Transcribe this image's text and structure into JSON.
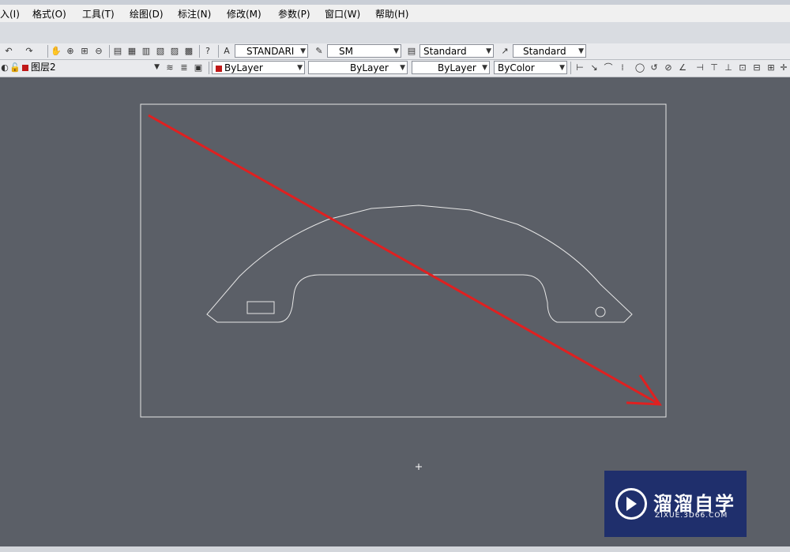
{
  "menu": [
    "入(I)",
    "格式(O)",
    "工具(T)",
    "绘图(D)",
    "标注(N)",
    "修改(M)",
    "参数(P)",
    "窗口(W)",
    "帮助(H)"
  ],
  "styles_toolbar": {
    "text_style": "STANDARI",
    "dim_style": "SM",
    "table_style": "Standard",
    "multileader_style": "Standard"
  },
  "layers_toolbar": {
    "current_layer": "图层2",
    "color": "ByLayer",
    "linetype": "ByLayer",
    "lineweight": "ByLayer",
    "plot_style": "ByColor"
  },
  "colors": {
    "canvas": "#5b5f67",
    "geometry": "#e6e6e6",
    "annotation_arrow": "#e02020",
    "layer_swatch": "#c01818"
  },
  "watermark": {
    "title": "溜溜自学",
    "url": "ZIXUE.3D66.COM"
  }
}
